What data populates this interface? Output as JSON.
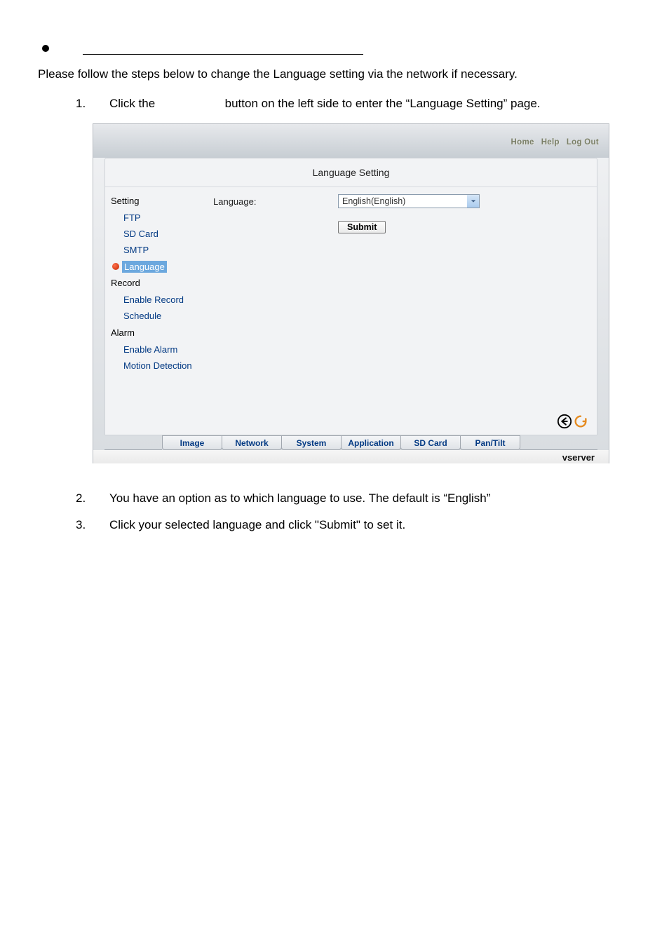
{
  "intro": "Please follow the steps below to change the Language setting via the network if necessary.",
  "steps": {
    "s1a": "1.",
    "s1b_pre": "Click the ",
    "s1b_post": " button on the left side to enter the “Language Setting” page.",
    "s2a": "2.",
    "s2b": "You have an option as to which language to use. The default is “English”",
    "s3a": "3.",
    "s3b": "Click your selected language and click \"Submit\" to set it."
  },
  "top_links": {
    "home": "Home",
    "help": "Help",
    "logout": "Log Out"
  },
  "panel": {
    "title": "Language Setting",
    "form": {
      "label": "Language:",
      "selected": "English(English)",
      "submit": "Submit"
    }
  },
  "sidebar": {
    "setting": "Setting",
    "ftp": "FTP",
    "sdcard": "SD Card",
    "smtp": "SMTP",
    "language": "Language",
    "record": "Record",
    "enable_record": "Enable Record",
    "schedule": "Schedule",
    "alarm": "Alarm",
    "enable_alarm": "Enable Alarm",
    "motion": "Motion Detection"
  },
  "tabs": {
    "image": "Image",
    "network": "Network",
    "system": "System",
    "application": "Application",
    "sdcard": "SD Card",
    "pantilt": "Pan/Tilt"
  },
  "footer": "vserver"
}
